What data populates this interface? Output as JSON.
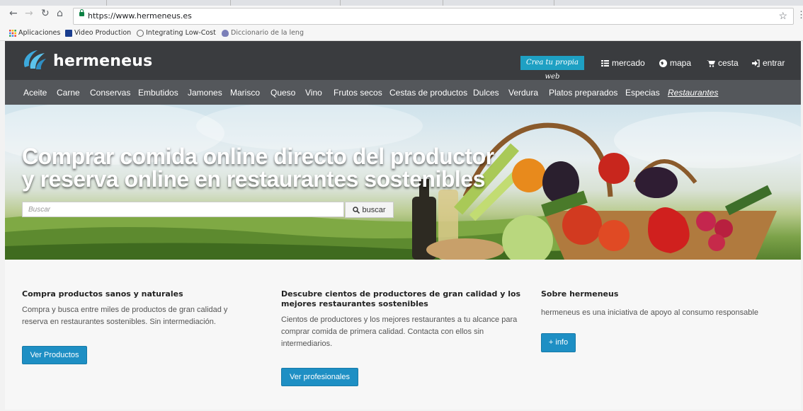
{
  "browser": {
    "url": "https://www.hermeneus.es",
    "bookmarks": [
      "Aplicaciones",
      "Video Production",
      "Integrating Low-Cost",
      "Diccionario de la leng"
    ]
  },
  "site": {
    "logo_text": "hermeneus",
    "cta_badge": "Crea tu propia web",
    "top_nav": [
      {
        "label": "mercado",
        "icon": "grid-icon"
      },
      {
        "label": "mapa",
        "icon": "globe-icon"
      },
      {
        "label": "cesta",
        "icon": "cart-icon"
      },
      {
        "label": "entrar",
        "icon": "login-icon"
      }
    ],
    "categories": [
      "Aceite",
      "Carne",
      "Conservas",
      "Embutidos",
      "Jamones",
      "Marisco",
      "Queso",
      "Vino",
      "Frutos secos",
      "Cestas de productos",
      "Dulces",
      "Verdura",
      "Platos preparados",
      "Especias",
      "Restaurantes"
    ]
  },
  "hero": {
    "headline_line1": "Comprar comida online directo del productor",
    "headline_line2": "y reserva online en restaurantes sostenibles",
    "search_placeholder": "Buscar",
    "search_button": "buscar"
  },
  "columns": [
    {
      "title": "Compra productos sanos y naturales",
      "text": "Compra y busca entre miles de productos de gran calidad y reserva en restaurantes sostenibles. Sin intermediación.",
      "button": "Ver Productos"
    },
    {
      "title": "Descubre cientos de productores de gran calidad y los mejores restaurantes sostenibles",
      "text": "Cientos de productores y los mejores restaurantes a tu alcance para comprar comida de primera calidad. Contacta con ellos sin intermediarios.",
      "button": "Ver profesionales"
    },
    {
      "title": "Sobre hermeneus",
      "text": "hermeneus es una iniciativa de apoyo al consumo responsable",
      "button": "+ info"
    }
  ],
  "colors": {
    "topbar": "#3a3c3f",
    "catbar": "#54575b",
    "accent": "#1ea0c3",
    "button": "#1e8fc4"
  }
}
